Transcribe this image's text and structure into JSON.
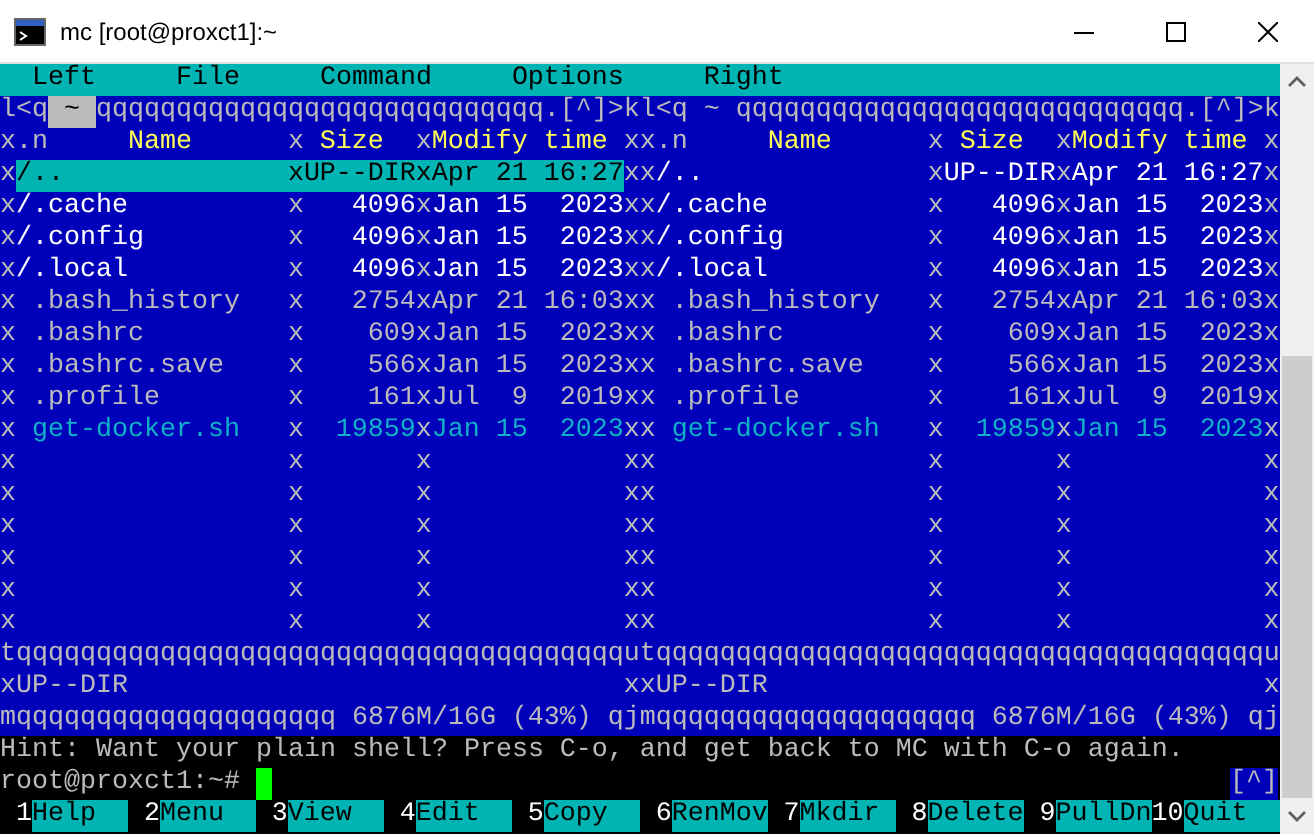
{
  "window": {
    "title": "mc [root@proxct1]:~"
  },
  "menu": [
    {
      "label": "Left"
    },
    {
      "label": "File"
    },
    {
      "label": "Command"
    },
    {
      "label": "Options"
    },
    {
      "label": "Right"
    }
  ],
  "panels": [
    {
      "active": true,
      "top": {
        "left": "l<q",
        "path": "~",
        "right": "qqqqqqqqqqqqqqqqqqqqqqqqqqqq.[^]>k"
      },
      "header": {
        "left": "x",
        "sort": ".n",
        "name": "Name",
        "sep1": "x",
        "size": "Size",
        "sep2": "x",
        "modified": "Modify time",
        "right": "x"
      },
      "files": [
        {
          "left": "x",
          "name": "/..",
          "sep1": "x",
          "size": "UP--DIR",
          "sep2": "x",
          "modified": "Apr 21 16:27",
          "right": "x",
          "kind": "dir",
          "selected": true
        },
        {
          "left": "x",
          "name": "/.cache",
          "sep1": "x",
          "size": "4096",
          "sep2": "x",
          "modified": "Jan 15  2023",
          "right": "x",
          "kind": "dir",
          "selected": false
        },
        {
          "left": "x",
          "name": "/.config",
          "sep1": "x",
          "size": "4096",
          "sep2": "x",
          "modified": "Jan 15  2023",
          "right": "x",
          "kind": "dir",
          "selected": false
        },
        {
          "left": "x",
          "name": "/.local",
          "sep1": "x",
          "size": "4096",
          "sep2": "x",
          "modified": "Jan 15  2023",
          "right": "x",
          "kind": "dir",
          "selected": false
        },
        {
          "left": "x",
          "name": ".bash_history",
          "sep1": "x",
          "size": "2754",
          "sep2": "x",
          "modified": "Apr 21 16:03",
          "right": "x",
          "kind": "file",
          "selected": false
        },
        {
          "left": "x",
          "name": ".bashrc",
          "sep1": "x",
          "size": "609",
          "sep2": "x",
          "modified": "Jan 15  2023",
          "right": "x",
          "kind": "file",
          "selected": false
        },
        {
          "left": "x",
          "name": ".bashrc.save",
          "sep1": "x",
          "size": "566",
          "sep2": "x",
          "modified": "Jan 15  2023",
          "right": "x",
          "kind": "file",
          "selected": false
        },
        {
          "left": "x",
          "name": ".profile",
          "sep1": "x",
          "size": "161",
          "sep2": "x",
          "modified": "Jul  9  2019",
          "right": "x",
          "kind": "file",
          "selected": false
        },
        {
          "left": "x",
          "name": "get-docker.sh",
          "sep1": "x",
          "size": "19859",
          "sep2": "x",
          "modified": "Jan 15  2023",
          "right": "x",
          "kind": "exe",
          "selected": false
        }
      ],
      "blank_rows": [
        {
          "borders": [
            "x",
            "x",
            "x",
            "x"
          ]
        },
        {
          "borders": [
            "x",
            "x",
            "x",
            "x"
          ]
        },
        {
          "borders": [
            "x",
            "x",
            "x",
            "x"
          ]
        },
        {
          "borders": [
            "x",
            "x",
            "x",
            "x"
          ]
        },
        {
          "borders": [
            "x",
            "x",
            "x",
            "x"
          ]
        },
        {
          "borders": [
            "x",
            "x",
            "x",
            "x"
          ]
        }
      ],
      "separator": "tqqqqqqqqqqqqqqqqqqqqqqqqqqqqqqqqqqqqqqu",
      "status": {
        "left": "x",
        "text": "UP--DIR",
        "right": "x"
      },
      "bottom": {
        "left": "mqqqqqqqqqqqqqqqqqqqq",
        "disk": "6876M/16G (43%)",
        "right": "qj"
      }
    },
    {
      "active": false,
      "top": {
        "left": "l<q",
        "path": "~",
        "right": "qqqqqqqqqqqqqqqqqqqqqqqqqqqq.[^]>k"
      },
      "header": {
        "left": "x",
        "sort": ".n",
        "name": "Name",
        "sep1": "x",
        "size": "Size",
        "sep2": "x",
        "modified": "Modify time",
        "right": "x"
      },
      "files": [
        {
          "left": "x",
          "name": "/..",
          "sep1": "x",
          "size": "UP--DIR",
          "sep2": "x",
          "modified": "Apr 21 16:27",
          "right": "x",
          "kind": "dir",
          "selected": false
        },
        {
          "left": "x",
          "name": "/.cache",
          "sep1": "x",
          "size": "4096",
          "sep2": "x",
          "modified": "Jan 15  2023",
          "right": "x",
          "kind": "dir",
          "selected": false
        },
        {
          "left": "x",
          "name": "/.config",
          "sep1": "x",
          "size": "4096",
          "sep2": "x",
          "modified": "Jan 15  2023",
          "right": "x",
          "kind": "dir",
          "selected": false
        },
        {
          "left": "x",
          "name": "/.local",
          "sep1": "x",
          "size": "4096",
          "sep2": "x",
          "modified": "Jan 15  2023",
          "right": "x",
          "kind": "dir",
          "selected": false
        },
        {
          "left": "x",
          "name": ".bash_history",
          "sep1": "x",
          "size": "2754",
          "sep2": "x",
          "modified": "Apr 21 16:03",
          "right": "x",
          "kind": "file",
          "selected": false
        },
        {
          "left": "x",
          "name": ".bashrc",
          "sep1": "x",
          "size": "609",
          "sep2": "x",
          "modified": "Jan 15  2023",
          "right": "x",
          "kind": "file",
          "selected": false
        },
        {
          "left": "x",
          "name": ".bashrc.save",
          "sep1": "x",
          "size": "566",
          "sep2": "x",
          "modified": "Jan 15  2023",
          "right": "x",
          "kind": "file",
          "selected": false
        },
        {
          "left": "x",
          "name": ".profile",
          "sep1": "x",
          "size": "161",
          "sep2": "x",
          "modified": "Jul  9  2019",
          "right": "x",
          "kind": "file",
          "selected": false
        },
        {
          "left": "x",
          "name": "get-docker.sh",
          "sep1": "x",
          "size": "19859",
          "sep2": "x",
          "modified": "Jan 15  2023",
          "right": "x",
          "kind": "exe",
          "selected": false
        }
      ],
      "blank_rows": [
        {
          "borders": [
            "x",
            "x",
            "x",
            "x"
          ]
        },
        {
          "borders": [
            "x",
            "x",
            "x",
            "x"
          ]
        },
        {
          "borders": [
            "x",
            "x",
            "x",
            "x"
          ]
        },
        {
          "borders": [
            "x",
            "x",
            "x",
            "x"
          ]
        },
        {
          "borders": [
            "x",
            "x",
            "x",
            "x"
          ]
        },
        {
          "borders": [
            "x",
            "x",
            "x",
            "x"
          ]
        }
      ],
      "separator": "tqqqqqqqqqqqqqqqqqqqqqqqqqqqqqqqqqqqqqqu",
      "status": {
        "left": "x",
        "text": "UP--DIR",
        "right": "x"
      },
      "bottom": {
        "left": "mqqqqqqqqqqqqqqqqqqqq",
        "disk": "6876M/16G (43%)",
        "right": "qj"
      }
    }
  ],
  "hint": "Hint: Want your plain shell? Press C-o, and get back to MC with C-o again.",
  "prompt": "root@proxct1:~#",
  "cursor": true,
  "history_button": "[^]",
  "function_keys": [
    {
      "number": "1",
      "label": "Help"
    },
    {
      "number": "2",
      "label": "Menu"
    },
    {
      "number": "3",
      "label": "View"
    },
    {
      "number": "4",
      "label": "Edit"
    },
    {
      "number": "5",
      "label": "Copy"
    },
    {
      "number": "6",
      "label": "RenMov"
    },
    {
      "number": "7",
      "label": "Mkdir"
    },
    {
      "number": "8",
      "label": "Delete"
    },
    {
      "number": "9",
      "label": "PullDn"
    },
    {
      "number": "10",
      "label": "Quit"
    }
  ]
}
